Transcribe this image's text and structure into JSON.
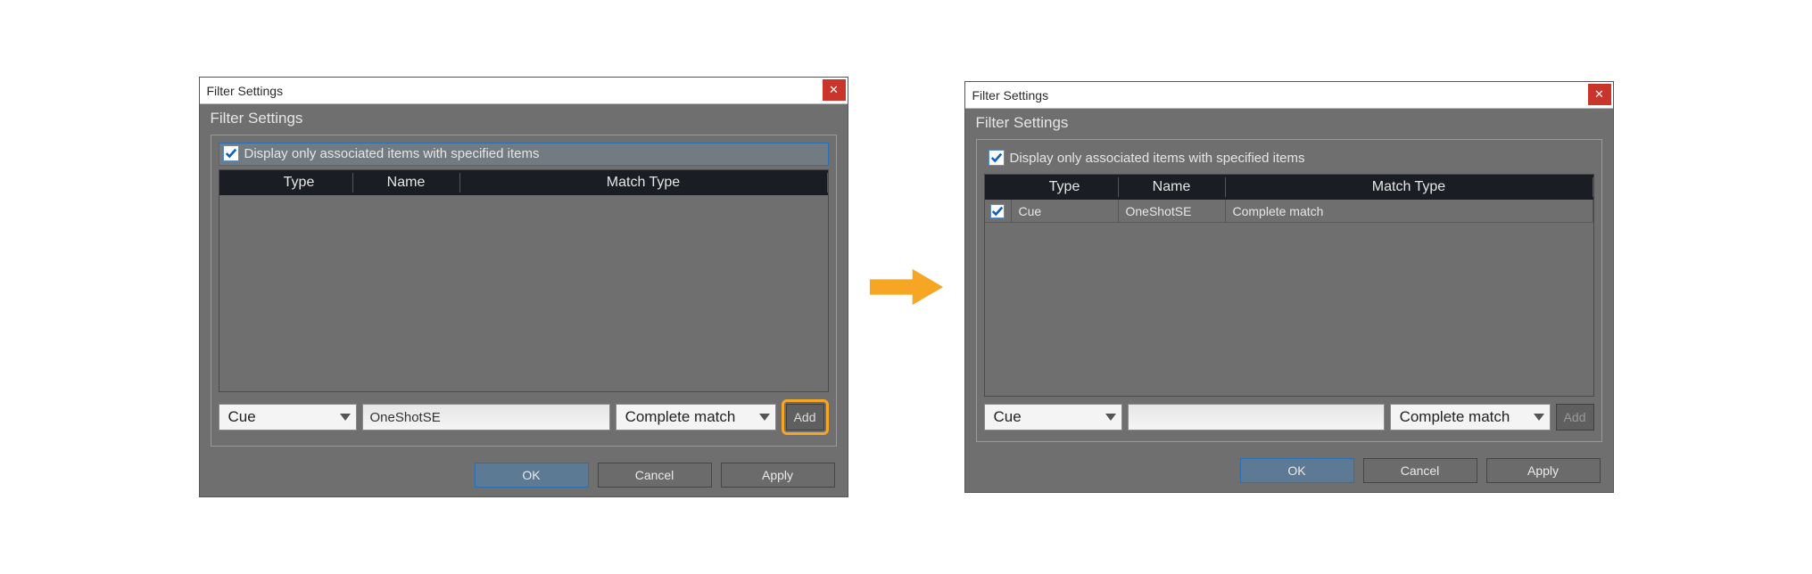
{
  "arrowColor": "#f6a623",
  "left": {
    "windowTitle": "Filter Settings",
    "groupTitle": "Filter Settings",
    "displayOnlyLabel": "Display only associated items with specified items",
    "displayOnlyChecked": true,
    "headers": {
      "type": "Type",
      "name": "Name",
      "match": "Match Type"
    },
    "rows": [],
    "typeSelect": "Cue",
    "nameInput": "OneShotSE",
    "matchSelect": "Complete match",
    "addLabel": "Add",
    "addDisabled": false,
    "addHighlighted": true,
    "buttons": {
      "ok": "OK",
      "cancel": "Cancel",
      "apply": "Apply"
    }
  },
  "right": {
    "windowTitle": "Filter Settings",
    "groupTitle": "Filter Settings",
    "displayOnlyLabel": "Display only associated items with specified items",
    "displayOnlyChecked": true,
    "headers": {
      "type": "Type",
      "name": "Name",
      "match": "Match Type"
    },
    "rows": [
      {
        "checked": true,
        "type": "Cue",
        "name": "OneShotSE",
        "match": "Complete match"
      }
    ],
    "typeSelect": "Cue",
    "nameInput": "",
    "matchSelect": "Complete match",
    "addLabel": "Add",
    "addDisabled": true,
    "addHighlighted": false,
    "buttons": {
      "ok": "OK",
      "cancel": "Cancel",
      "apply": "Apply"
    }
  }
}
